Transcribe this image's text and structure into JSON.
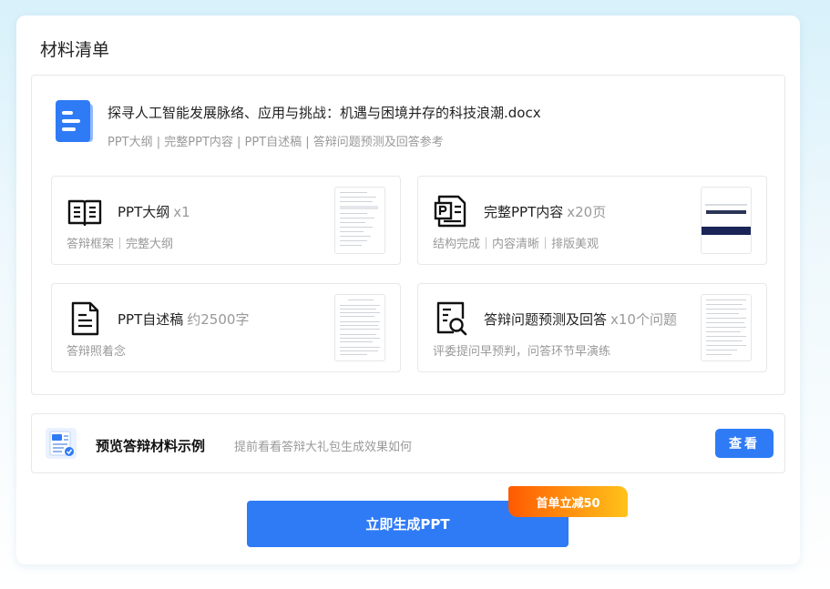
{
  "title": "材料清单",
  "document": {
    "name": "探寻人工智能发展脉络、应用与挑战：机遇与困境并存的科技浪潮.docx",
    "subtitle": "PPT大纲 | 完整PPT内容 | PPT自述稿 | 答辩问题预测及回答参考",
    "icon": "document-icon"
  },
  "items": [
    {
      "name": "PPT大纲",
      "qty": "x1",
      "desc": "答辩框架｜完整大纲",
      "icon": "book-icon"
    },
    {
      "name": "完整PPT内容",
      "qty": "x20页",
      "desc": "结构完成｜内容清晰｜排版美观",
      "icon": "ppt-icon"
    },
    {
      "name": "PPT自述稿",
      "qty": "约2500字",
      "desc": "答辩照着念",
      "icon": "script-icon"
    },
    {
      "name": "答辩问题预测及回答",
      "qty": "x10个问题",
      "desc": "评委提问早预判，问答环节早演练",
      "icon": "search-document-icon"
    }
  ],
  "preview": {
    "title": "预览答辩材料示例",
    "subtitle": "提前看看答辩大礼包生成效果如何",
    "button": "查看"
  },
  "generate_button": "立即生成PPT",
  "badge": "首单立减50",
  "colors": {
    "accent": "#2f7bf6",
    "badge_start": "#ff5a00",
    "badge_end": "#ffc21a"
  }
}
